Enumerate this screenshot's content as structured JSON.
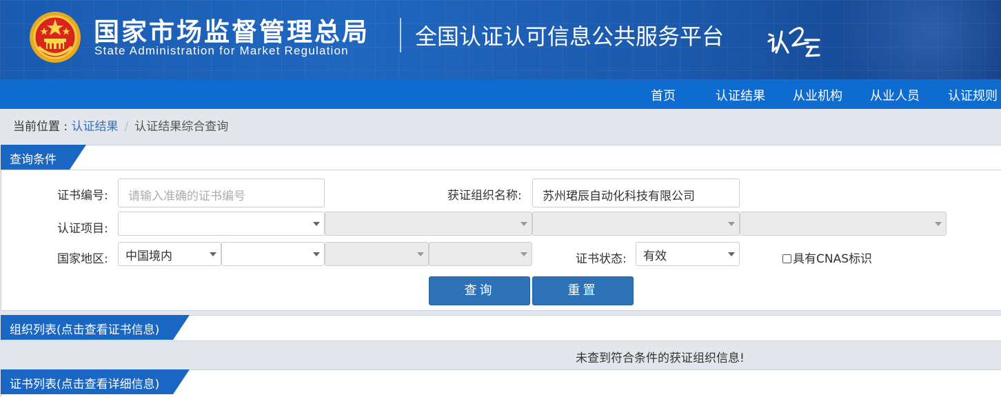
{
  "header": {
    "agency_cn": "国家市场监督管理总局",
    "agency_en": "State Administration  for  Market Regulation",
    "platform_title": "全国认证认可信息公共服务平台",
    "brand_mark": "认e云",
    "emblem_icon": "national-emblem-icon"
  },
  "nav": {
    "items": [
      {
        "label": "首页"
      },
      {
        "label": "认证结果"
      },
      {
        "label": "从业机构"
      },
      {
        "label": "从业人员"
      },
      {
        "label": "认证规则"
      }
    ]
  },
  "breadcrumb": {
    "prefix": "当前位置 : ",
    "link": "认证结果",
    "separator": "/",
    "current": "认证结果综合查询"
  },
  "query_panel": {
    "title": "查询条件",
    "cert_no": {
      "label": "证书编号:",
      "placeholder": "请输入准确的证书编号",
      "value": ""
    },
    "org_name": {
      "label": "获证组织名称:",
      "value": "苏州珺辰自动化科技有限公司"
    },
    "cert_project": {
      "label": "认证项目:",
      "selects": [
        "",
        "",
        "",
        ""
      ]
    },
    "region": {
      "label": "国家地区:",
      "selects": [
        "中国境内",
        "",
        "",
        ""
      ]
    },
    "cert_status": {
      "label": "证书状态:",
      "value": "有效"
    },
    "cnas": {
      "label": "具有CNAS标识",
      "checked": false
    },
    "buttons": {
      "query": "查询",
      "reset": "重置"
    }
  },
  "org_panel": {
    "title": "组织列表(点击查看证书信息)",
    "empty_message": "未查到符合条件的获证组织信息!"
  },
  "cert_panel": {
    "title": "证书列表(点击查看详细信息)"
  },
  "colors": {
    "header_blue": "#1f66c0",
    "nav_blue": "#0e6bd0",
    "tab_blue": "#1a66c3",
    "button_blue": "#2d72b7",
    "link_blue": "#3a6fb5"
  }
}
